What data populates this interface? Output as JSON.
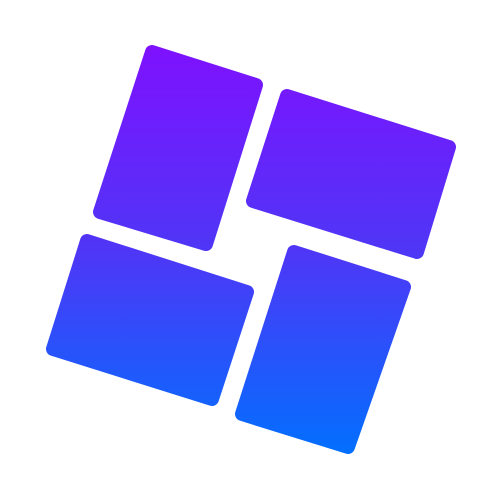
{
  "logo": {
    "icon_name": "four-tile-grid-icon",
    "gradient_top": "#8010FF",
    "gradient_mid": "#4F36F6",
    "gradient_bottom": "#0071FF",
    "background": "#ffffff"
  }
}
